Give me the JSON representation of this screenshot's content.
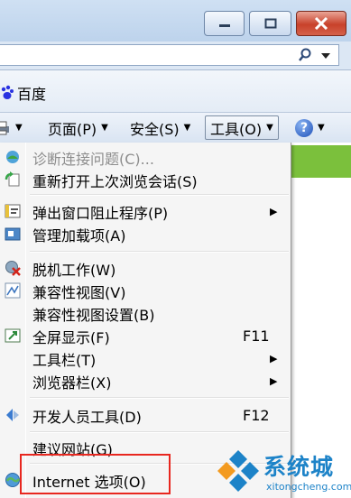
{
  "favorites": {
    "link_label": "百度"
  },
  "command_bar": {
    "page_label": "页面(P)",
    "safety_label": "安全(S)",
    "tools_label": "工具(O)"
  },
  "tools_menu": {
    "items": [
      {
        "label": "诊断连接问题(C)...",
        "shortcut": "",
        "disabled": true,
        "submenu": false,
        "icon": "diagnose-connection-icon"
      },
      {
        "label": "重新打开上次浏览会话(S)",
        "shortcut": "",
        "disabled": false,
        "submenu": false,
        "icon": "reopen-session-icon"
      },
      {
        "label": "弹出窗口阻止程序(P)",
        "shortcut": "",
        "disabled": false,
        "submenu": true,
        "icon": "popup-blocker-icon"
      },
      {
        "label": "管理加载项(A)",
        "shortcut": "",
        "disabled": false,
        "submenu": false,
        "icon": "manage-addons-icon"
      },
      {
        "label": "脱机工作(W)",
        "shortcut": "",
        "disabled": false,
        "submenu": false,
        "icon": "work-offline-icon"
      },
      {
        "label": "兼容性视图(V)",
        "shortcut": "",
        "disabled": false,
        "submenu": false,
        "icon": "compatibility-view-icon"
      },
      {
        "label": "兼容性视图设置(B)",
        "shortcut": "",
        "disabled": false,
        "submenu": false,
        "icon": ""
      },
      {
        "label": "全屏显示(F)",
        "shortcut": "F11",
        "disabled": false,
        "submenu": false,
        "icon": "full-screen-icon"
      },
      {
        "label": "工具栏(T)",
        "shortcut": "",
        "disabled": false,
        "submenu": true,
        "icon": ""
      },
      {
        "label": "浏览器栏(X)",
        "shortcut": "",
        "disabled": false,
        "submenu": true,
        "icon": ""
      },
      {
        "label": "开发人员工具(D)",
        "shortcut": "F12",
        "disabled": false,
        "submenu": false,
        "icon": "developer-tools-icon"
      },
      {
        "label": "建议网站(G)",
        "shortcut": "",
        "disabled": false,
        "submenu": false,
        "icon": ""
      },
      {
        "label": "Internet 选项(O)",
        "shortcut": "",
        "disabled": false,
        "submenu": false,
        "icon": "internet-options-icon"
      }
    ]
  },
  "watermark": {
    "name": "系统城",
    "url": "xitongcheng.com"
  }
}
